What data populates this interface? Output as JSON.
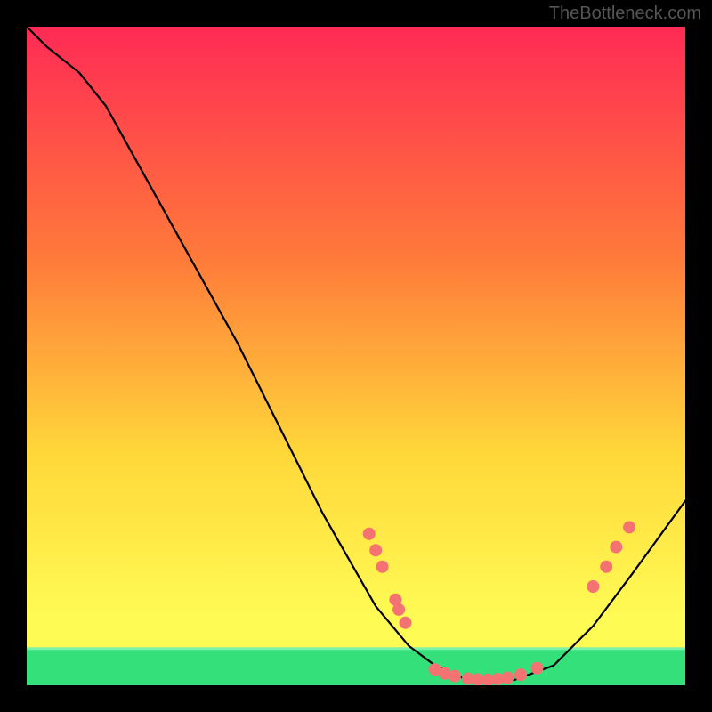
{
  "watermark": "TheBottleneck.com",
  "chart_data": {
    "type": "line",
    "title": "",
    "xlabel": "",
    "ylabel": "",
    "xlim": [
      0,
      100
    ],
    "ylim": [
      0,
      100
    ],
    "background_gradient": {
      "top": "#ff2a55",
      "mid1": "#ff7a3a",
      "mid2": "#ffd83a",
      "mid3": "#fffb55",
      "bottom_band": "#34e07a",
      "band_top_fraction": 0.945
    },
    "curve": {
      "name": "bottleneck-curve",
      "color": "#000000",
      "points": [
        {
          "x": 0,
          "y": 100
        },
        {
          "x": 3,
          "y": 97
        },
        {
          "x": 8,
          "y": 93
        },
        {
          "x": 12,
          "y": 88
        },
        {
          "x": 32,
          "y": 52
        },
        {
          "x": 45,
          "y": 26
        },
        {
          "x": 53,
          "y": 12
        },
        {
          "x": 58,
          "y": 6
        },
        {
          "x": 62,
          "y": 3
        },
        {
          "x": 66,
          "y": 1.2
        },
        {
          "x": 70,
          "y": 0.6
        },
        {
          "x": 74,
          "y": 0.8
        },
        {
          "x": 80,
          "y": 3
        },
        {
          "x": 86,
          "y": 9
        },
        {
          "x": 92,
          "y": 17
        },
        {
          "x": 100,
          "y": 28
        }
      ]
    },
    "markers": {
      "name": "data-points",
      "color": "#f47272",
      "radius": 7,
      "points": [
        {
          "x": 52,
          "y": 23
        },
        {
          "x": 53,
          "y": 20.5
        },
        {
          "x": 54,
          "y": 18
        },
        {
          "x": 56,
          "y": 13
        },
        {
          "x": 56.5,
          "y": 11.5
        },
        {
          "x": 57.5,
          "y": 9.5
        },
        {
          "x": 62,
          "y": 2.4
        },
        {
          "x": 63.5,
          "y": 1.8
        },
        {
          "x": 65,
          "y": 1.4
        },
        {
          "x": 67,
          "y": 1.0
        },
        {
          "x": 68.5,
          "y": 0.9
        },
        {
          "x": 70,
          "y": 0.85
        },
        {
          "x": 71.5,
          "y": 0.95
        },
        {
          "x": 73,
          "y": 1.15
        },
        {
          "x": 75,
          "y": 1.6
        },
        {
          "x": 77.5,
          "y": 2.6
        },
        {
          "x": 86,
          "y": 15
        },
        {
          "x": 88,
          "y": 18
        },
        {
          "x": 89.5,
          "y": 21
        },
        {
          "x": 91.5,
          "y": 24
        }
      ]
    }
  }
}
